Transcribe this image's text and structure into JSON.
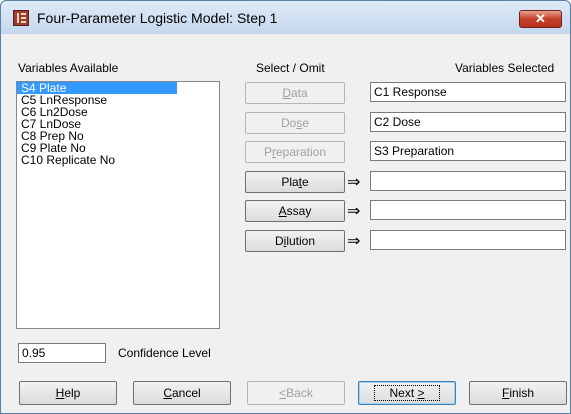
{
  "window": {
    "title": "Four-Parameter Logistic Model: Step 1",
    "close_glyph": "✕"
  },
  "headers": {
    "available": "Variables Available",
    "select_omit": "Select / Omit",
    "selected": "Variables Selected"
  },
  "available_list": [
    "S4 Plate",
    "C5 LnResponse",
    "C6 Ln2Dose",
    "C7 LnDose",
    "C8 Prep No",
    "C9 Plate No",
    "C10 Replicate No"
  ],
  "select_buttons": {
    "data": {
      "pre": "",
      "ul": "D",
      "post": "ata"
    },
    "dose": {
      "pre": "Do",
      "ul": "s",
      "post": "e"
    },
    "preparation": {
      "pre": "P",
      "ul": "r",
      "post": "eparation"
    },
    "plate": {
      "pre": "Pla",
      "ul": "t",
      "post": "e"
    },
    "assay": {
      "pre": "",
      "ul": "A",
      "post": "ssay"
    },
    "dilution": {
      "pre": "D",
      "ul": "i",
      "post": "lution"
    }
  },
  "arrow_glyph": "⇒",
  "selected_fields": {
    "data": "C1 Response",
    "dose": "C2 Dose",
    "preparation": "S3 Preparation",
    "plate": "",
    "assay": "",
    "dilution": ""
  },
  "confidence": {
    "value": "0.95",
    "label": "Confidence Level"
  },
  "bottom_buttons": {
    "help": {
      "ul": "H",
      "post": "elp"
    },
    "cancel": {
      "ul": "C",
      "post": "ancel"
    },
    "back": {
      "pre": "",
      "ul": "<",
      "post": " Back"
    },
    "next": {
      "pre": "Next ",
      "ul": ">"
    },
    "finish": {
      "ul": "F",
      "post": "inish"
    }
  },
  "colors": {
    "selection": "#3399ff",
    "close": "#c5402a"
  },
  "icons": {
    "app": "app-chart-icon",
    "close": "close-icon"
  }
}
